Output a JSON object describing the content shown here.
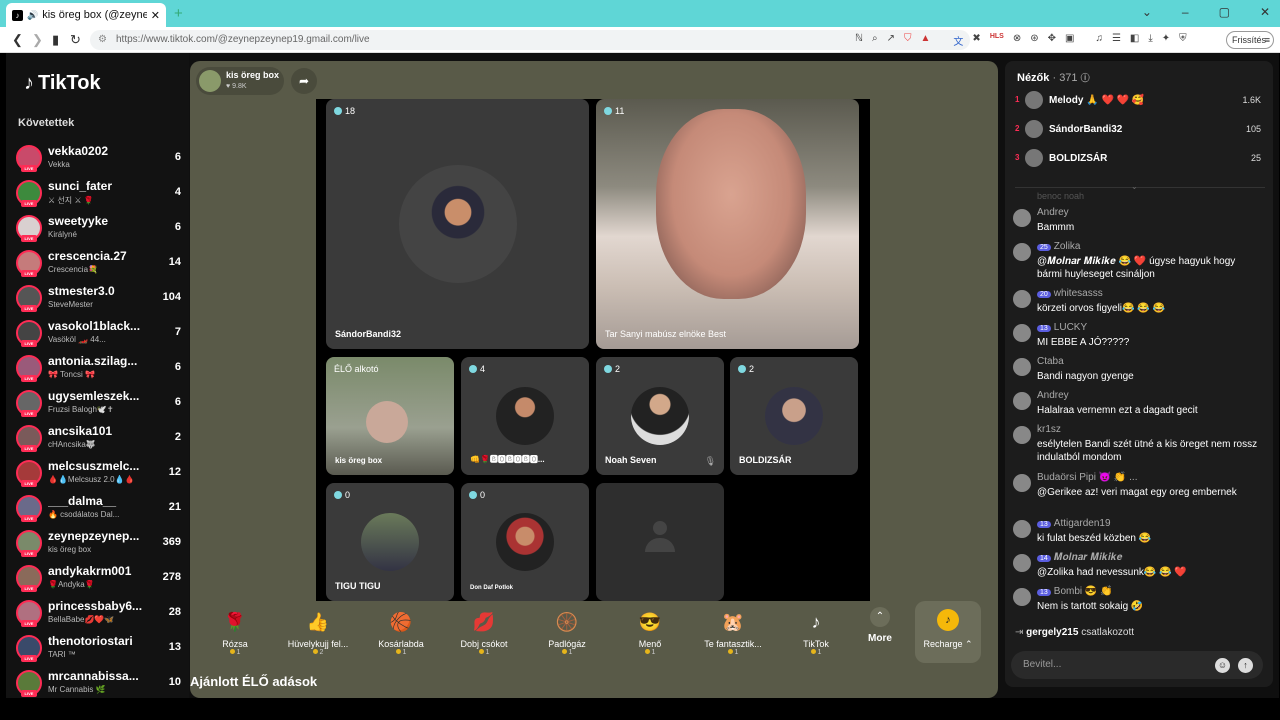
{
  "browser": {
    "tab_title": "kis öreg box (@zeynepzeyne",
    "url": "https://www.tiktok.com/@zeynepzeynep19.gmail.com/live",
    "refresh_label": "Frissítés",
    "ext_labels": [
      "HLS"
    ]
  },
  "sidebar": {
    "logo": "TikTok",
    "following_title": "Követettek",
    "live_badge": "LIVE",
    "users": [
      {
        "name": "vekka0202",
        "sub": "Vekka",
        "count": "6",
        "color": "#c94a6a"
      },
      {
        "name": "sunci_fater",
        "sub": "⚔ 선지 ⚔ 🌹",
        "count": "4",
        "color": "#3d8a3d"
      },
      {
        "name": "sweetyyke",
        "sub": "Királyné",
        "count": "6",
        "color": "#d9d0d0"
      },
      {
        "name": "crescencia.27",
        "sub": "Crescencia💐",
        "count": "14",
        "color": "#c57b7b"
      },
      {
        "name": "stmester3.0",
        "sub": "SteveMester",
        "count": "104",
        "color": "#555"
      },
      {
        "name": "vasokol1black...",
        "sub": "Vasököl 🏎️ 44...",
        "count": "7",
        "color": "#444"
      },
      {
        "name": "antonia.szilag...",
        "sub": "🎀 Toncsi 🎀",
        "count": "6",
        "color": "#9a5a7a"
      },
      {
        "name": "ugysemleszek...",
        "sub": "Fruzsi Balogh🕊️✝",
        "count": "6",
        "color": "#666"
      },
      {
        "name": "ancsika101",
        "sub": "cHAncsika🐺",
        "count": "2",
        "color": "#7a5a5a"
      },
      {
        "name": "melcsuszmelc...",
        "sub": "🩸💧Melcsusz 2.0💧🩸",
        "count": "12",
        "color": "#a53a3a"
      },
      {
        "name": "___dalma__",
        "sub": "🔥 csodálatos Dal...",
        "count": "21",
        "color": "#6a6a8a"
      },
      {
        "name": "zeynepzeynep...",
        "sub": "kis öreg box",
        "count": "369",
        "color": "#7a8a6a"
      },
      {
        "name": "andykakrm001",
        "sub": "🌹Andyka🌹",
        "count": "278",
        "color": "#8a6a5a"
      },
      {
        "name": "princessbaby6...",
        "sub": "BellaBabe💋❤️🦋",
        "count": "28",
        "color": "#b07080"
      },
      {
        "name": "thenotoriostari",
        "sub": "TARI ™",
        "count": "13",
        "color": "#3a4a6a"
      },
      {
        "name": "mrcannabissa...",
        "sub": "Mr Cannabis 🌿",
        "count": "10",
        "color": "#5a7a3a"
      }
    ]
  },
  "stage": {
    "host_name": "kis öreg box",
    "host_likes": "♥ 9.8K",
    "tiles": [
      {
        "count": "18",
        "name": "SándorBandi32"
      },
      {
        "count": "11",
        "name": "Tar Sanyi mabúsz elnöke Best"
      },
      {
        "count": "ÉLŐ alkotó",
        "name": "kis öreg box"
      },
      {
        "count": "4",
        "name": "👊🌹🅱🅾🅱🅾🅱🅾..."
      },
      {
        "count": "2",
        "name": "Noah Seven"
      },
      {
        "count": "2",
        "name": "BOLDIZSÁR"
      },
      {
        "count": "0",
        "name": "TIGU TIGU"
      },
      {
        "count": "0",
        "name": "Don Daf Potlok"
      }
    ]
  },
  "gifts": [
    {
      "name": "Rózsa",
      "price": "1",
      "icon": "🌹"
    },
    {
      "name": "Hüvelykujj fel...",
      "price": "2",
      "icon": "👍"
    },
    {
      "name": "Kosárlabda",
      "price": "1",
      "icon": "🏀"
    },
    {
      "name": "Dobj csókot",
      "price": "1",
      "icon": "💋"
    },
    {
      "name": "Padlógáz",
      "price": "1",
      "icon": "🛞"
    },
    {
      "name": "Menő",
      "price": "1",
      "icon": "😎"
    },
    {
      "name": "Te fantasztik...",
      "price": "1",
      "icon": "🐹"
    },
    {
      "name": "TikTok",
      "price": "1",
      "icon": "♪"
    }
  ],
  "gift_controls": {
    "more_label": "More",
    "recharge_label": "Recharge ⌃"
  },
  "recommended_title": "Ajánlott ÉLŐ adások",
  "viewers": {
    "title": "Nézők",
    "count": "· 371",
    "top": [
      {
        "rank": "1",
        "name": "Melody 🙏 ❤️ ❤️ 🥰",
        "score": "1.6K"
      },
      {
        "rank": "2",
        "name": "SándorBandi32",
        "score": "105"
      },
      {
        "rank": "3",
        "name": "BOLDIZSÁR",
        "score": "25"
      }
    ]
  },
  "chat": {
    "faded_line": "benoc noah",
    "messages": [
      {
        "user": "Andrey",
        "level": "",
        "text": "Bammm"
      },
      {
        "user": "Zolika",
        "level": "25",
        "text": "@𝑴𝒐𝒍𝒏𝒂𝒓 𝑴𝒊𝒌𝒊𝒌𝒆 😂 ❤️ úgyse hagyuk hogy bármi huyleseget csináljon"
      },
      {
        "user": "whitesasss",
        "level": "20",
        "text": "körzeti orvos figyeli😂 😂 😂"
      },
      {
        "user": "LUCKY",
        "level": "13",
        "text": "MI EBBE A JÓ?????"
      },
      {
        "user": "Ctaba",
        "level": "",
        "text": "Bandi nagyon gyenge"
      },
      {
        "user": "Andrey",
        "level": "",
        "text": "Halalraa vernemn ezt a dagadt gecit"
      },
      {
        "user": "kr1sz",
        "level": "",
        "text": "esélytelen Bandi szét ütné a kis öreget nem rossz indulatból mondom"
      },
      {
        "user": "Budaörsi Pipi 😈 👏 ...",
        "level": "",
        "text": "@Gerikee az! veri magat egy oreg embernek"
      },
      {
        "user": "Attigarden19",
        "level": "13",
        "text": "ki fulat beszéd közben 😂"
      },
      {
        "user": "𝑴𝒐𝒍𝒏𝒂𝒓 𝑴𝒊𝒌𝒊𝒌𝒆",
        "level": "14",
        "text": "@Zolika had nevessunk😂 😂 ❤️"
      },
      {
        "user": "Bombi 😎 👏",
        "level": "13",
        "text": "Nem is tartott sokaig 🤣"
      }
    ],
    "joined_user": "gergely215",
    "joined_text": "csatlakozott",
    "input_placeholder": "Bevitel..."
  }
}
